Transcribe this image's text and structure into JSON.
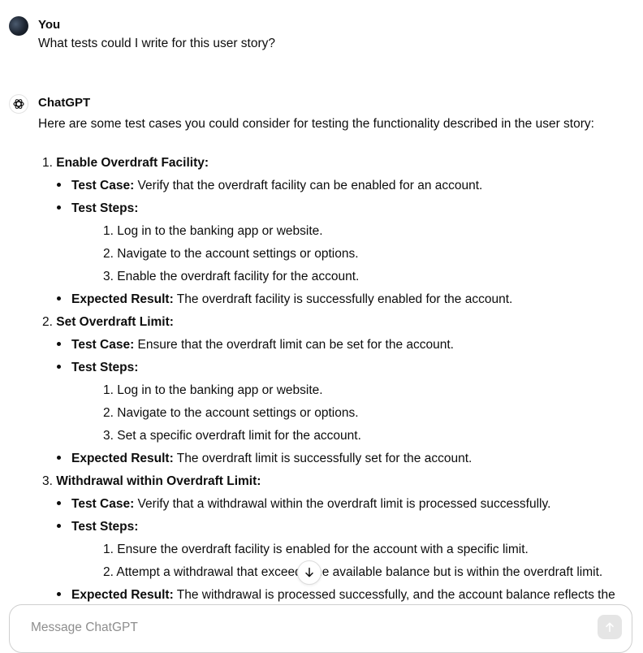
{
  "user_message": {
    "author": "You",
    "text": "What tests could I write for this user story?"
  },
  "assistant_message": {
    "author": "ChatGPT",
    "intro": "Here are some test cases you could consider for testing the functionality described in the user story:",
    "sections": [
      {
        "number": "1.",
        "title": "Enable Overdraft Facility:",
        "test_case_label": "Test Case:",
        "test_case": " Verify that the overdraft facility can be enabled for an account.",
        "steps_label": "Test Steps:",
        "steps": [
          {
            "n": "1.",
            "text": "Log in to the banking app or website."
          },
          {
            "n": "2.",
            "text": "Navigate to the account settings or options."
          },
          {
            "n": "3.",
            "text": "Enable the overdraft facility for the account."
          }
        ],
        "result_label": "Expected Result:",
        "result": " The overdraft facility is successfully enabled for the account."
      },
      {
        "number": "2.",
        "title": "Set Overdraft Limit:",
        "test_case_label": "Test Case:",
        "test_case": " Ensure that the overdraft limit can be set for the account.",
        "steps_label": "Test Steps:",
        "steps": [
          {
            "n": "1.",
            "text": "Log in to the banking app or website."
          },
          {
            "n": "2.",
            "text": "Navigate to the account settings or options."
          },
          {
            "n": "3.",
            "text": "Set a specific overdraft limit for the account."
          }
        ],
        "result_label": "Expected Result:",
        "result": " The overdraft limit is successfully set for the account."
      },
      {
        "number": "3.",
        "title": "Withdrawal within Overdraft Limit:",
        "test_case_label": "Test Case:",
        "test_case": " Verify that a withdrawal within the overdraft limit is processed successfully.",
        "steps_label": "Test Steps:",
        "steps": [
          {
            "n": "1.",
            "text": "Ensure the overdraft facility is enabled for the account with a specific limit."
          },
          {
            "n": "2.",
            "text": "Attempt a withdrawal that exceeds the available balance but is within the overdraft limit."
          }
        ],
        "result_label": "Expected Result:",
        "result": " The withdrawal is processed successfully, and the account balance reflects the"
      }
    ]
  },
  "composer": {
    "placeholder": "Message ChatGPT"
  },
  "icons": {
    "scroll_down": "arrow-down-icon",
    "send": "arrow-up-icon",
    "assistant_logo": "openai-logo-icon"
  }
}
